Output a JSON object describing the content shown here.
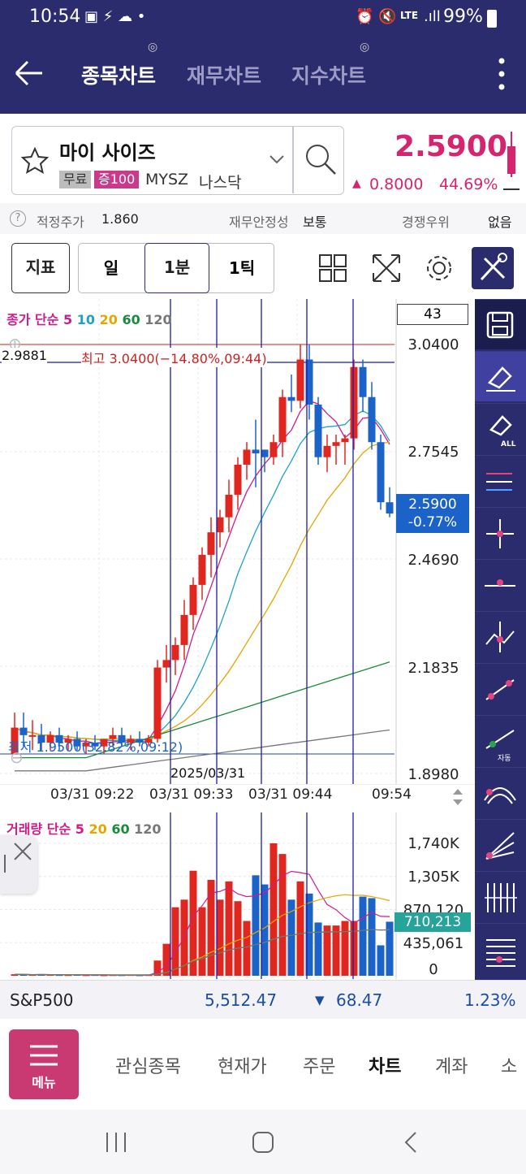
{
  "status": {
    "time": "10:54",
    "battery": "99%",
    "network": "LTE"
  },
  "appbar": {
    "tabs": [
      "종목차트",
      "재무차트",
      "지수차트"
    ],
    "active_tab": 0
  },
  "stock": {
    "name": "마이 사이즈",
    "tags": [
      "무료",
      "증100"
    ],
    "ticker": "MYSZ",
    "market": "나스닥",
    "price": "2.5900",
    "change": "0.8000",
    "change_pct": "44.69%",
    "up_color": "#d6246e"
  },
  "info": {
    "fair_price_label": "적정주가",
    "fair_price": "1.860",
    "stability_label": "재무안정성",
    "stability": "보통",
    "competition_label": "경쟁우위",
    "competition": "없음"
  },
  "controls": {
    "indicator": "지표",
    "periods": [
      "일",
      "1분",
      "1틱"
    ],
    "active_period": "1분"
  },
  "chart": {
    "legend": {
      "prefix": "종가 단순",
      "periods": [
        "5",
        "10",
        "20",
        "60",
        "120"
      ],
      "colors": [
        "#d01c8b",
        "#1fa2c8",
        "#e0a800",
        "#1a8a3c",
        "#777777"
      ]
    },
    "count_box": "43",
    "left_value": "2.9881",
    "high_label": "최고 3.0400(−14.80%,09:44)",
    "low_label": "최저 1.9500(32.82%,09:12)",
    "price_tag": "2.5900",
    "price_tag_pct": "-0.77%",
    "y_ticks": [
      "3.0400",
      "2.7545",
      "2.4690",
      "2.1835",
      "1.8980"
    ],
    "x_ticks": [
      "03/31 09:22",
      "03/31 09:33",
      "03/31 09:44",
      "09:54"
    ],
    "overlap_date": "2025/03/31"
  },
  "volume": {
    "legend": {
      "prefix": "거래량 단순",
      "periods": [
        "5",
        "20",
        "60",
        "120"
      ],
      "colors": [
        "#d01c8b",
        "#e0a800",
        "#1a8a3c",
        "#777777"
      ]
    },
    "y_ticks": [
      "1,740K",
      "1,305K",
      "870,120",
      "435,061",
      "0"
    ],
    "tag": "710,213"
  },
  "index": {
    "name": "S&P500",
    "value": "5,512.47",
    "change": "68.47",
    "pct": "1.23%"
  },
  "bottom_nav": {
    "menu": "메뉴",
    "items": [
      "관심종목",
      "현재가",
      "주문",
      "차트",
      "계좌",
      "소"
    ],
    "active": "차트"
  },
  "chart_data": [
    {
      "type": "candlestick",
      "title": "",
      "x": [
        "09:12",
        "09:13",
        "09:14",
        "09:15",
        "09:16",
        "09:17",
        "09:18",
        "09:19",
        "09:20",
        "09:21",
        "09:22",
        "09:23",
        "09:24",
        "09:25",
        "09:26",
        "09:27",
        "09:28",
        "09:29",
        "09:30",
        "09:31",
        "09:32",
        "09:33",
        "09:34",
        "09:35",
        "09:36",
        "09:37",
        "09:38",
        "09:39",
        "09:40",
        "09:41",
        "09:42",
        "09:43",
        "09:44",
        "09:45",
        "09:46",
        "09:47",
        "09:48",
        "09:49",
        "09:50",
        "09:51",
        "09:52",
        "09:53",
        "09:54"
      ],
      "series": [
        {
          "open": 1.95,
          "high": 2.06,
          "low": 1.95,
          "close": 2.02
        },
        {
          "open": 2.02,
          "high": 2.06,
          "low": 1.97,
          "close": 2.0
        },
        {
          "open": 2.0,
          "high": 2.04,
          "low": 1.96,
          "close": 2.0
        },
        {
          "open": 2.0,
          "high": 2.03,
          "low": 1.96,
          "close": 1.98
        },
        {
          "open": 1.98,
          "high": 2.01,
          "low": 1.96,
          "close": 2.0
        },
        {
          "open": 2.0,
          "high": 2.02,
          "low": 1.96,
          "close": 1.98
        },
        {
          "open": 1.98,
          "high": 2.0,
          "low": 1.96,
          "close": 1.99
        },
        {
          "open": 1.99,
          "high": 2.01,
          "low": 1.96,
          "close": 1.97
        },
        {
          "open": 1.97,
          "high": 1.99,
          "low": 1.95,
          "close": 1.98
        },
        {
          "open": 1.98,
          "high": 2.0,
          "low": 1.96,
          "close": 1.97
        },
        {
          "open": 1.97,
          "high": 1.99,
          "low": 1.95,
          "close": 1.99
        },
        {
          "open": 1.99,
          "high": 2.02,
          "low": 1.97,
          "close": 2.0
        },
        {
          "open": 2.0,
          "high": 2.02,
          "low": 1.97,
          "close": 1.98
        },
        {
          "open": 1.98,
          "high": 2.0,
          "low": 1.96,
          "close": 1.99
        },
        {
          "open": 1.99,
          "high": 2.01,
          "low": 1.97,
          "close": 1.98
        },
        {
          "open": 1.98,
          "high": 2.0,
          "low": 1.97,
          "close": 1.99
        },
        {
          "open": 1.99,
          "high": 2.2,
          "low": 1.98,
          "close": 2.18
        },
        {
          "open": 2.18,
          "high": 2.24,
          "low": 2.14,
          "close": 2.2
        },
        {
          "open": 2.2,
          "high": 2.26,
          "low": 2.16,
          "close": 2.24
        },
        {
          "open": 2.24,
          "high": 2.36,
          "low": 2.2,
          "close": 2.32
        },
        {
          "open": 2.32,
          "high": 2.42,
          "low": 2.28,
          "close": 2.4
        },
        {
          "open": 2.4,
          "high": 2.5,
          "low": 2.36,
          "close": 2.48
        },
        {
          "open": 2.48,
          "high": 2.58,
          "low": 2.42,
          "close": 2.54
        },
        {
          "open": 2.54,
          "high": 2.6,
          "low": 2.5,
          "close": 2.58
        },
        {
          "open": 2.58,
          "high": 2.68,
          "low": 2.54,
          "close": 2.64
        },
        {
          "open": 2.64,
          "high": 2.74,
          "low": 2.6,
          "close": 2.72
        },
        {
          "open": 2.72,
          "high": 2.78,
          "low": 2.68,
          "close": 2.76
        },
        {
          "open": 2.76,
          "high": 2.84,
          "low": 2.66,
          "close": 2.75
        },
        {
          "open": 2.76,
          "high": 2.76,
          "low": 2.7,
          "close": 2.74
        },
        {
          "open": 2.74,
          "high": 2.8,
          "low": 2.72,
          "close": 2.78
        },
        {
          "open": 2.78,
          "high": 2.92,
          "low": 2.74,
          "close": 2.9
        },
        {
          "open": 2.9,
          "high": 2.96,
          "low": 2.86,
          "close": 2.89
        },
        {
          "open": 2.89,
          "high": 3.04,
          "low": 2.87,
          "close": 3.0
        },
        {
          "open": 3.0,
          "high": 3.04,
          "low": 2.84,
          "close": 2.88
        },
        {
          "open": 2.88,
          "high": 2.9,
          "low": 2.72,
          "close": 2.74
        },
        {
          "open": 2.74,
          "high": 2.8,
          "low": 2.7,
          "close": 2.77
        },
        {
          "open": 2.77,
          "high": 2.8,
          "low": 2.72,
          "close": 2.78
        },
        {
          "open": 2.78,
          "high": 2.8,
          "low": 2.72,
          "close": 2.79
        },
        {
          "open": 2.79,
          "high": 3.0,
          "low": 2.76,
          "close": 2.98
        },
        {
          "open": 2.98,
          "high": 3.0,
          "low": 2.86,
          "close": 2.9
        },
        {
          "open": 2.9,
          "high": 2.94,
          "low": 2.76,
          "close": 2.78
        },
        {
          "open": 2.78,
          "high": 2.8,
          "low": 2.6,
          "close": 2.62
        },
        {
          "open": 2.62,
          "high": 2.66,
          "low": 2.58,
          "close": 2.59
        }
      ],
      "ylim": [
        1.898,
        3.04
      ],
      "y_ticks": [
        3.04,
        2.7545,
        2.469,
        2.1835,
        1.898
      ],
      "moving_averages": [
        "5",
        "10",
        "20",
        "60",
        "120"
      ]
    },
    {
      "type": "bar",
      "title": "",
      "categories_count": 43,
      "values": [
        20000,
        15000,
        10000,
        18000,
        12000,
        9000,
        8000,
        11000,
        7000,
        9000,
        6000,
        8000,
        7000,
        9000,
        6000,
        8000,
        200000,
        420000,
        900000,
        1000000,
        1380000,
        900000,
        1260000,
        1000000,
        1240000,
        980000,
        720000,
        1320000,
        1200000,
        1740000,
        1600000,
        1000000,
        1240000,
        1080000,
        700000,
        660000,
        660000,
        720000,
        720000,
        1040000,
        1020000,
        400000,
        710213
      ],
      "colors_up": "#e0271f",
      "colors_down": "#1b63c9",
      "ylim": [
        0,
        1740000
      ]
    }
  ]
}
